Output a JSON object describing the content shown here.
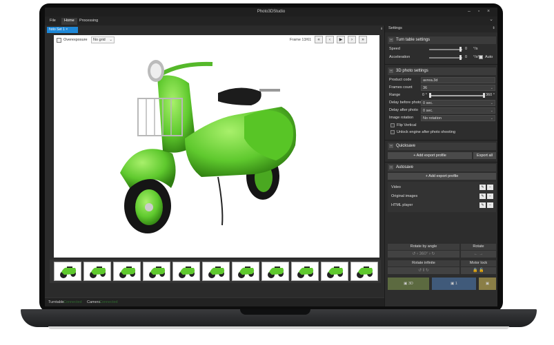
{
  "app": {
    "title": "Photo3DStudio"
  },
  "menu": {
    "file": "File",
    "home": "Home",
    "processing": "Processing"
  },
  "document": {
    "tab": "hoto Set 1",
    "tab_close": "×"
  },
  "viewport": {
    "overexposure_label": "Overexposure",
    "grid_value": "No grid",
    "frame_label": "Frame 13/61",
    "nav": [
      "«",
      "‹",
      "▶",
      "›",
      "»"
    ]
  },
  "status": {
    "turntable_label": "Turntable",
    "turntable_state": "Connected",
    "camera_label": "Camera",
    "camera_state": "Connected"
  },
  "settings": {
    "header": "Settings",
    "turntable": {
      "title": "Turn table settings",
      "speed_label": "Speed",
      "speed_value": "0",
      "speed_unit": "°/s",
      "accel_label": "Acceleration",
      "accel_value": "0",
      "accel_unit": "°/s²",
      "auto_label": "Auto"
    },
    "photo3d": {
      "title": "3D photo settings",
      "product_code_label": "Product code",
      "product_code": "avrea.3d",
      "frames_label": "Frames count",
      "frames": "36",
      "range_label": "Range",
      "range_min": "0 °",
      "range_max": "360 °",
      "delay_before_label": "Delay before photo",
      "delay_before": "0 sec.",
      "delay_after_label": "Delay after photo",
      "delay_after": "0 sec.",
      "rotation_label": "Image rotation",
      "rotation": "No rotation",
      "flip_label": "Flip Vertical",
      "unlock_label": "Unlock engine after photo shooting"
    },
    "quicksave": {
      "title": "Quicksave",
      "add_profile": "+ Add export profile",
      "export_all": "Export all"
    },
    "autosave": {
      "title": "Autosave",
      "add_profile": "+ Add export profile",
      "items": [
        "Video",
        "Original images",
        "HTML player"
      ]
    },
    "controls": {
      "rotate_by_angle": "Rotate by angle",
      "rotate": "Rotate",
      "angle_value": "360°",
      "rotate_infinite": "Rotate infinite",
      "motor_lock": "Motor lock",
      "btn_3d": "3D",
      "btn_1": "1"
    }
  },
  "colors": {
    "accent": "#1e88d8",
    "scooter": "#6fd23b",
    "status_green": "#2f6a2f"
  }
}
